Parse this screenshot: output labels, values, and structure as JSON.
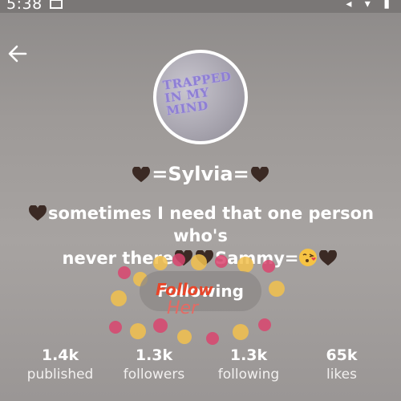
{
  "status_bar": {
    "time": "5:38"
  },
  "header": {
    "back_icon": "arrow-left-icon"
  },
  "profile": {
    "avatar_text": "TRAPPED IN MY MIND",
    "name": "=Sylvia=",
    "bio_line1": "sometimes I need that one person who's",
    "bio_line2_a": "never there",
    "bio_line2_b": "Sammy="
  },
  "follow_button": {
    "label": "Following",
    "sticker_text": "Follow",
    "sticker_sub": "Her"
  },
  "stats": [
    {
      "value": "1.4k",
      "label": "published"
    },
    {
      "value": "1.3k",
      "label": "followers"
    },
    {
      "value": "1.3k",
      "label": "following"
    },
    {
      "value": "65k",
      "label": "likes"
    }
  ],
  "colors": {
    "heart": "#3b2a24",
    "sticker_red": "#e8462a",
    "dot_pink": "#d9456e",
    "dot_yellow": "#f2c14e"
  }
}
